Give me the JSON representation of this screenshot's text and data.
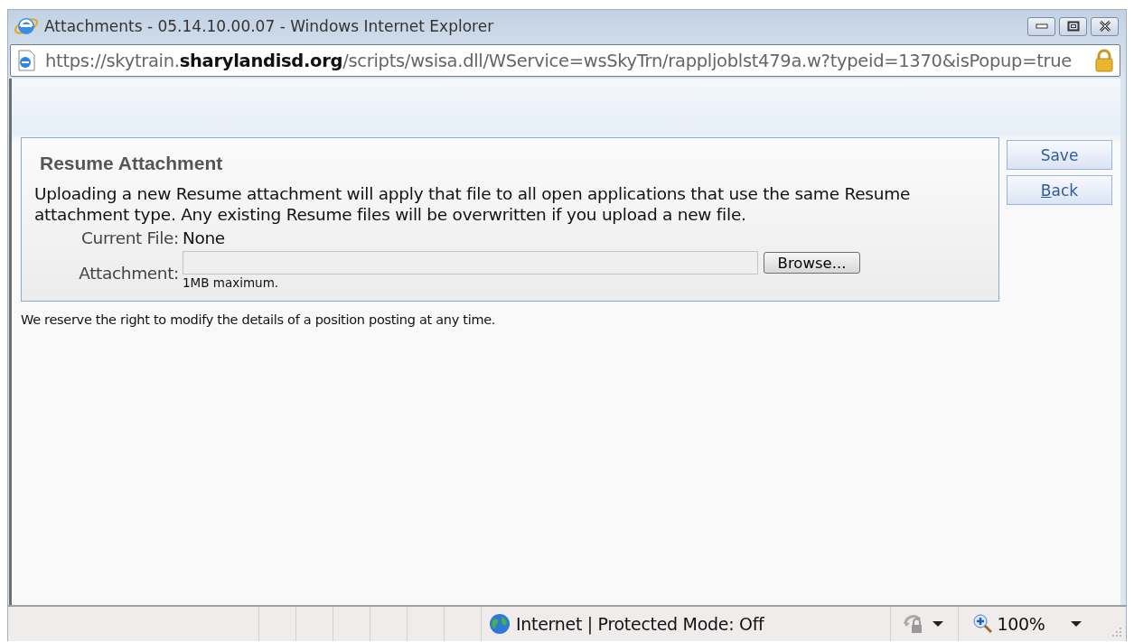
{
  "window": {
    "title": "Attachments - 05.14.10.00.07 - Windows Internet Explorer"
  },
  "address_bar": {
    "url": "https://skytrain.**sharylandisd.org**/scripts/wsisa.dll/WService=wsSkyTrn/rappljoblst479a.w?typeid=1370&isPopup=true"
  },
  "panel": {
    "title": "Resume Attachment",
    "description": "Uploading a new Resume attachment will apply that file to all open applications that use the same Resume attachment type. Any existing Resume files will be overwritten if you upload a new file.",
    "fields": [
      {
        "kind": "text",
        "label": "Current File:",
        "value": "None"
      },
      {
        "kind": "file",
        "label": "Attachment:",
        "button": "Browse...",
        "hint": "1MB maximum."
      }
    ]
  },
  "buttons": [
    "Save",
    "Back"
  ],
  "footer": "We reserve the right to modify the details of a position posting at any time.",
  "status_bar": {
    "zone": "Internet | Protected Mode: Off",
    "zoom": "100%"
  }
}
